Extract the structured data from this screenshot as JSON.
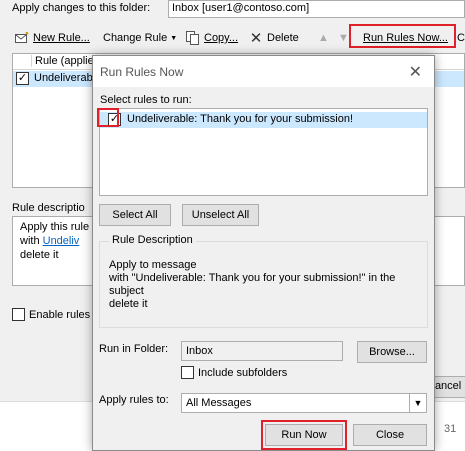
{
  "background": {
    "apply_label": "Apply changes to this folder:",
    "folder_value": "Inbox [user1@contoso.com]",
    "toolbar": {
      "new_rule": "New Rule...",
      "change_rule": "Change Rule",
      "copy": "Copy...",
      "delete": "Delete",
      "run_rules_now": "Run Rules Now...",
      "options_partial": "C"
    },
    "rules_list": {
      "column_header": "Rule (applie",
      "rows": [
        {
          "name": "Undeliverab",
          "checked": true
        }
      ]
    },
    "description_label": "Rule descriptio",
    "description": {
      "line1": "Apply this rule",
      "line2_prefix": "with ",
      "line2_link": "Undeliv",
      "line3": "delete it"
    },
    "enable_label": "Enable rules",
    "cancel_partial": "Cancel",
    "strip_number": "31"
  },
  "dialog": {
    "title": "Run Rules Now",
    "select_label": "Select rules to run:",
    "rules": [
      {
        "name": "Undeliverable: Thank you for your submission!",
        "checked": true
      }
    ],
    "select_all": "Select All",
    "unselect_all": "Unselect All",
    "rule_description_label": "Rule Description",
    "rule_description": {
      "line1": "Apply to message",
      "line2": "with \"Undeliverable: Thank you for your submission!\" in the",
      "line3": "subject",
      "line4": "delete it"
    },
    "run_in_folder_label": "Run in Folder:",
    "folder_value": "Inbox",
    "browse": "Browse...",
    "include_subfolders": "Include subfolders",
    "include_subfolders_checked": false,
    "apply_rules_to_label": "Apply rules to:",
    "apply_rules_to_value": "All Messages",
    "run_now": "Run Now",
    "close": "Close"
  },
  "highlight_color": "#e0202a",
  "selection_color": "#cce8ff"
}
